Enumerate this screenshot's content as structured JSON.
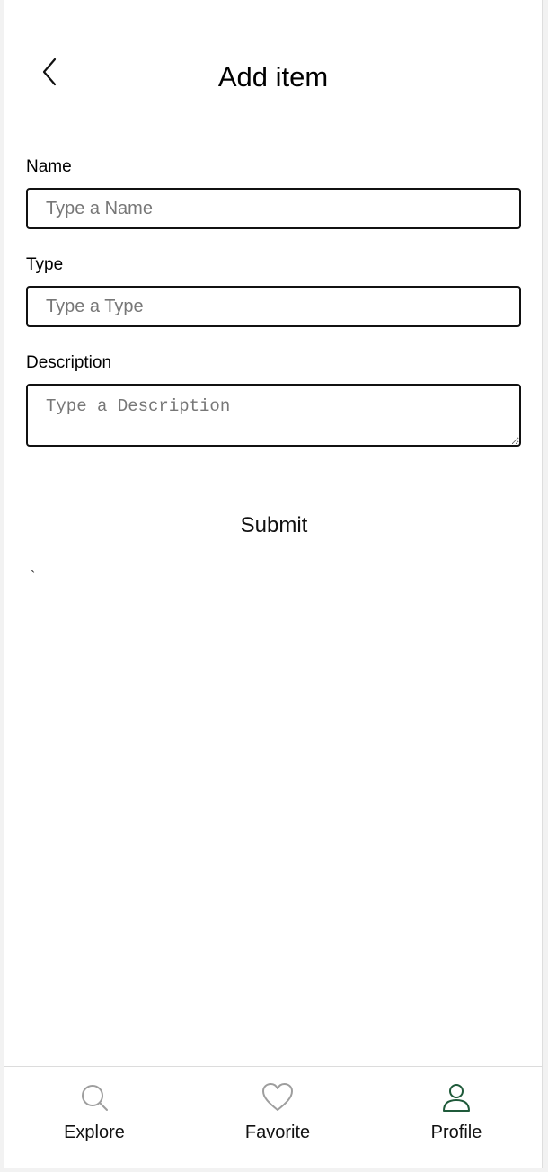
{
  "header": {
    "title": "Add item",
    "back_icon": "chevron-left-icon"
  },
  "form": {
    "name": {
      "label": "Name",
      "placeholder": "Type a Name",
      "value": ""
    },
    "type": {
      "label": "Type",
      "placeholder": "Type a Type",
      "value": ""
    },
    "description": {
      "label": "Description",
      "placeholder": "Type a Description",
      "value": ""
    },
    "submit_label": "Submit",
    "stray_text": "`"
  },
  "bottom_nav": {
    "items": [
      {
        "label": "Explore",
        "icon": "search-icon",
        "active": false
      },
      {
        "label": "Favorite",
        "icon": "heart-icon",
        "active": false
      },
      {
        "label": "Profile",
        "icon": "person-icon",
        "active": true
      }
    ]
  },
  "colors": {
    "inactive_icon": "#9e9e9e",
    "active_icon": "#1f5a3a",
    "border": "#111111"
  }
}
